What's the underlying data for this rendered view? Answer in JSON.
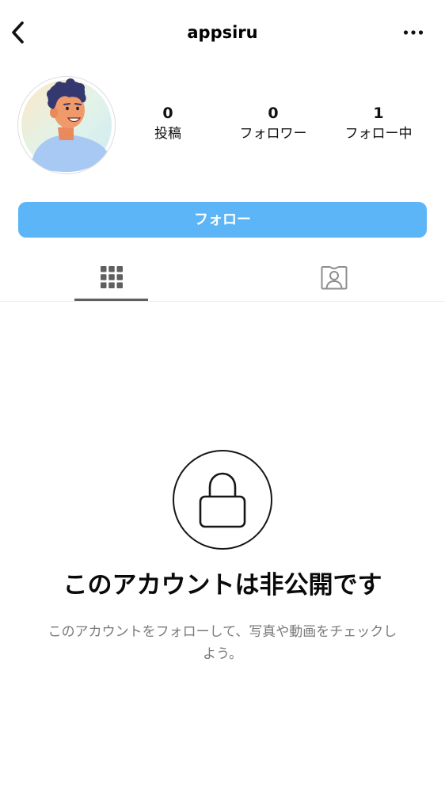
{
  "header": {
    "username": "appsiru",
    "back_icon": "chevron-left-icon",
    "more_icon": "more-horizontal-icon"
  },
  "profile": {
    "avatar_icon": "user-avatar-illustration",
    "stats": {
      "posts": {
        "count": "0",
        "label": "投稿"
      },
      "followers": {
        "count": "0",
        "label": "フォロワー"
      },
      "following": {
        "count": "1",
        "label": "フォロー中"
      }
    }
  },
  "follow_button": {
    "label": "フォロー",
    "color": "#5bb5f6"
  },
  "tabs": [
    {
      "icon": "grid-icon",
      "active": true
    },
    {
      "icon": "tagged-person-icon",
      "active": false
    }
  ],
  "private_notice": {
    "icon": "lock-icon",
    "title": "このアカウントは非公開です",
    "description": "このアカウントをフォローして、写真や動画をチェックしよう。"
  }
}
